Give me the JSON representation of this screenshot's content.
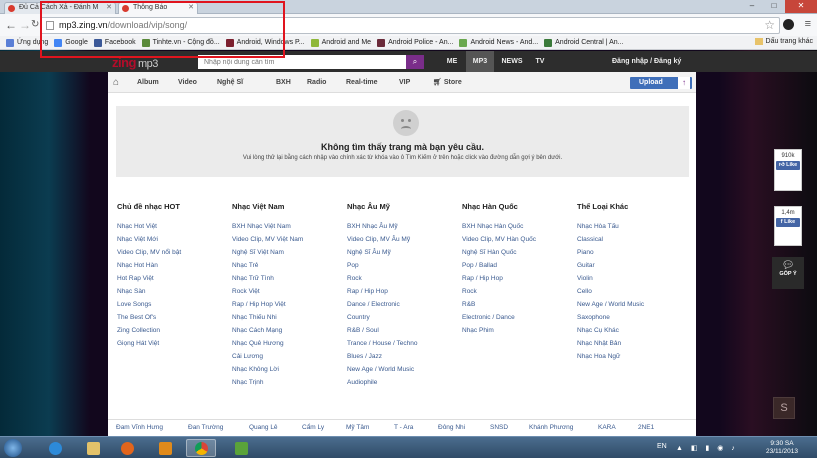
{
  "browser": {
    "tabs": [
      {
        "title": "Đủ Cả Cách Xả - Đánh M"
      },
      {
        "title": "Thông Báo"
      }
    ],
    "url_host": "mp3.zing.vn",
    "url_path": "/download/vip/song/",
    "bookmarks": [
      {
        "label": "Ứng dụng",
        "color": "#5a7fd6"
      },
      {
        "label": "Google",
        "color": "#4285f4"
      },
      {
        "label": "Facebook",
        "color": "#3b5998"
      },
      {
        "label": "Tinhte.vn - Cộng đồ...",
        "color": "#5a8a3a"
      },
      {
        "label": "Android, Windows P...",
        "color": "#7b1f2e"
      },
      {
        "label": "Android and Me",
        "color": "#8fb83a"
      },
      {
        "label": "Android Police - An...",
        "color": "#6a2a3a"
      },
      {
        "label": "Android News - And...",
        "color": "#6aa84f"
      },
      {
        "label": "Android Central | An...",
        "color": "#3a7a3a"
      }
    ],
    "other_bookmarks": "Dấu trang khác"
  },
  "site": {
    "logo_main": "zing",
    "logo_sub": "mp3",
    "search_placeholder": "Nhập nội dung cần tìm",
    "top_nav": [
      "ME",
      "MP3",
      "NEWS",
      "TV"
    ],
    "top_nav_active": "MP3",
    "login": "Đăng nhập / Đăng ký",
    "sub_nav": [
      "Album",
      "Video",
      "Nghệ Sĩ",
      "BXH",
      "Radio",
      "Real-time",
      "VIP",
      "Store"
    ],
    "upload_label": "Upload"
  },
  "error": {
    "title": "Không tìm thấy trang mà bạn yêu cầu.",
    "description": "Vui lòng thử lại bằng cách nhập vào chính xác từ khóa vào ô Tìm Kiếm ở trên hoặc click vào đường dẫn gợi ý bên dưới."
  },
  "columns": [
    {
      "heading": "Chủ đề nhạc HOT",
      "items": [
        "Nhạc Hot Việt",
        "Nhạc Việt Mới",
        "Video Clip, MV nổi bật",
        "Nhạc Hot Hàn",
        "Hot Rap Việt",
        "Nhạc Sàn",
        "Love Songs",
        "The Best Of's",
        "Zing Collection",
        "Giọng Hát Việt"
      ]
    },
    {
      "heading": "Nhạc Việt Nam",
      "items": [
        "BXH Nhạc Việt Nam",
        "Video Clip, MV Việt Nam",
        "Nghệ Sĩ Việt Nam",
        "Nhạc Trẻ",
        "Nhạc Trữ Tình",
        "Rock Việt",
        "Rap / Hip Hop Việt",
        "Nhạc Thiếu Nhi",
        "Nhạc Cách Mạng",
        "Nhạc Quê Hương",
        "Cải Lương",
        "Nhạc Không Lời",
        "Nhạc Trịnh"
      ]
    },
    {
      "heading": "Nhạc Âu Mỹ",
      "items": [
        "BXH Nhạc Âu Mỹ",
        "Video Clip, MV Âu Mỹ",
        "Nghệ Sĩ Âu Mỹ",
        "Pop",
        "Rock",
        "Rap / Hip Hop",
        "Dance / Electronic",
        "Country",
        "R&B / Soul",
        "Trance / House / Techno",
        "Blues / Jazz",
        "New Age / World Music",
        "Audiophile"
      ]
    },
    {
      "heading": "Nhạc Hàn Quốc",
      "items": [
        "BXH Nhạc Hàn Quốc",
        "Video Clip, MV Hàn Quốc",
        "Nghệ Sĩ Hàn Quốc",
        "Pop / Ballad",
        "Rap / Hip Hop",
        "Rock",
        "R&B",
        "Electronic / Dance",
        "Nhạc Phim"
      ]
    },
    {
      "heading": "Thể Loại Khác",
      "items": [
        "Nhạc Hòa Tấu",
        "Classical",
        "Piano",
        "Guitar",
        "Violin",
        "Cello",
        "New Age / World Music",
        "Saxophone",
        "Nhạc Cụ Khác",
        "Nhạc Nhật Bản",
        "Nhạc Hoa Ngữ"
      ]
    }
  ],
  "artists": [
    "Đam Vĩnh Hưng",
    "Đan Trường",
    "Quang Lê",
    "Cẩm Ly",
    "Mỹ Tâm",
    "T - Ara",
    "Đông Nhi",
    "SNSD",
    "Khánh Phương",
    "KARA",
    "2NE1"
  ],
  "widgets": {
    "like_count_1": "910k",
    "like_count_2": "1,4m",
    "like_label": "Like",
    "feedback_label": "GÓP Ý"
  },
  "taskbar": {
    "lang": "EN",
    "time": "9:30 SA",
    "date": "23/11/2013"
  }
}
